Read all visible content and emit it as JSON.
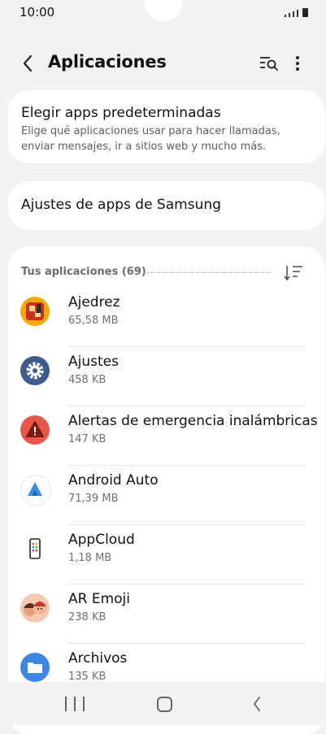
{
  "status": {
    "time": "10:00"
  },
  "header": {
    "title": "Aplicaciones"
  },
  "default_apps": {
    "title": "Elegir apps predeterminadas",
    "subtitle": "Elige qué aplicaciones usar para hacer llamadas, enviar mensajes, ir a sitios web y mucho más."
  },
  "samsung_settings": {
    "title": "Ajustes de apps de Samsung"
  },
  "apps_section": {
    "header": "Tus aplicaciones (69)"
  },
  "apps": [
    {
      "name": "Ajedrez",
      "size": "65,58 MB",
      "icon": "chess-icon"
    },
    {
      "name": "Ajustes",
      "size": "458 KB",
      "icon": "settings-gear-icon"
    },
    {
      "name": "Alertas de emergencia inalámbricas",
      "size": "147 KB",
      "icon": "warning-triangle-icon"
    },
    {
      "name": "Android Auto",
      "size": "71,39 MB",
      "icon": "android-auto-icon"
    },
    {
      "name": "AppCloud",
      "size": "1,18 MB",
      "icon": "phone-icon"
    },
    {
      "name": "AR Emoji",
      "size": "238 KB",
      "icon": "ar-emoji-icon"
    },
    {
      "name": "Archivos",
      "size": "135 KB",
      "icon": "folder-icon"
    }
  ],
  "colors": {
    "background": "#f2f2f4",
    "card": "#ffffff",
    "settings_icon": "#3f5b8c",
    "alert_icon": "#e8574a",
    "files_icon": "#3e86e6"
  }
}
